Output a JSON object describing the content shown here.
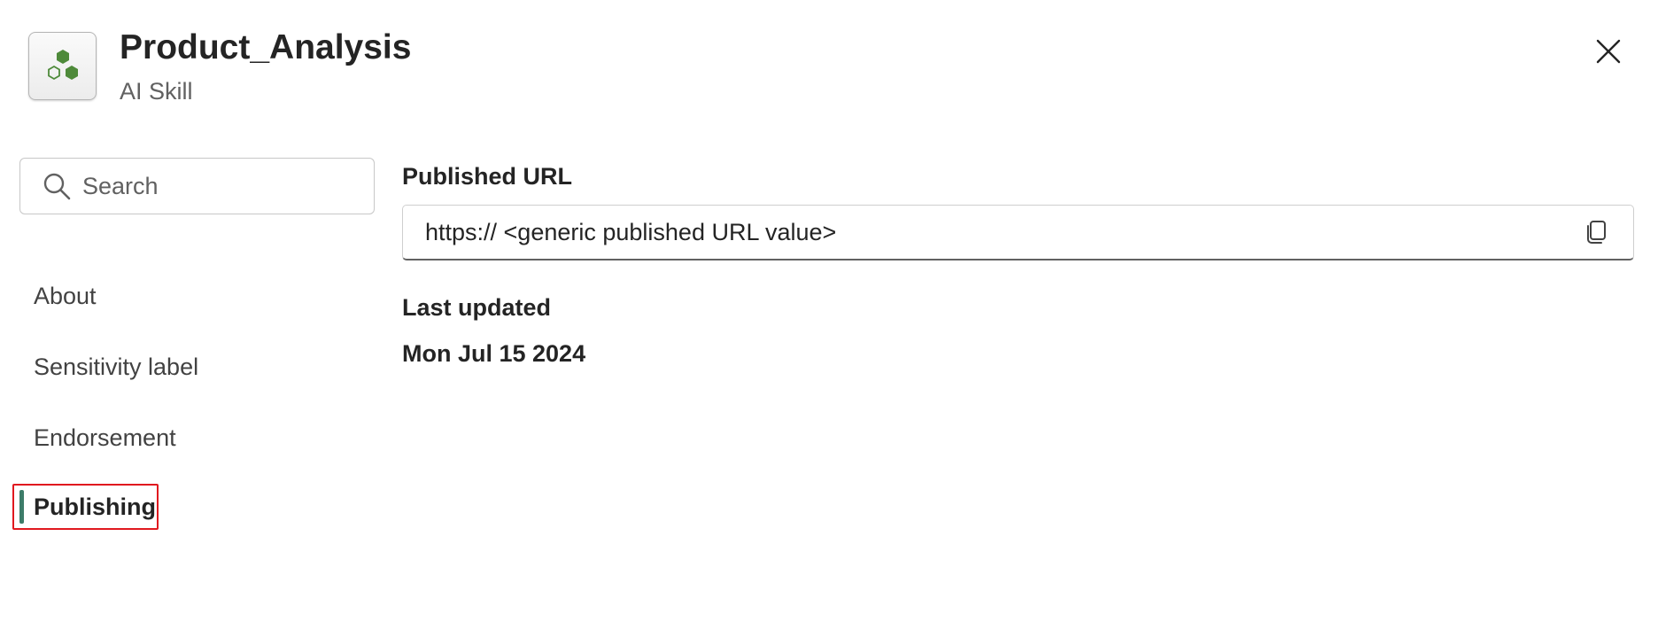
{
  "header": {
    "title": "Product_Analysis",
    "subtitle": "AI Skill",
    "app_icon": "ai-skill-hexagons-icon",
    "brand_color": "#4e8a3a"
  },
  "search": {
    "placeholder": "Search",
    "value": ""
  },
  "nav": {
    "items": [
      {
        "label": "About",
        "selected": false
      },
      {
        "label": "Sensitivity label",
        "selected": false
      },
      {
        "label": "Endorsement",
        "selected": false
      },
      {
        "label": "Publishing",
        "selected": true
      }
    ],
    "selected_indicator_color": "#3d7c69",
    "highlight_outline_color": "#e0191f"
  },
  "publishing": {
    "url_label": "Published URL",
    "url_value": "https:// <generic published URL value>",
    "last_updated_label": "Last updated",
    "last_updated_value": "Mon Jul 15 2024"
  }
}
